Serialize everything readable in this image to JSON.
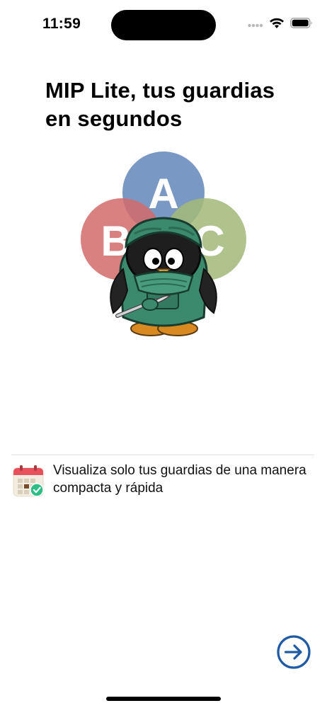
{
  "status_bar": {
    "time": "11:59",
    "icons": [
      "signal-dots-icon",
      "wifi-icon",
      "battery-icon"
    ]
  },
  "onboarding": {
    "title": "MIP Lite, tus guardias en segundos",
    "hero": {
      "circle_letters": [
        "A",
        "B",
        "C"
      ],
      "colors": {
        "a": "#6f8fbf",
        "b": "#d26a6a",
        "c": "#a3b978",
        "scrubs": "#3c8a6e"
      }
    },
    "feature": {
      "icon": "calendar-check-icon",
      "text": "Visualiza solo tus guardias de una manera compacta y rápida"
    },
    "next_button_icon": "arrow-right-circle-icon"
  },
  "colors": {
    "accent": "#1f5aa6"
  }
}
